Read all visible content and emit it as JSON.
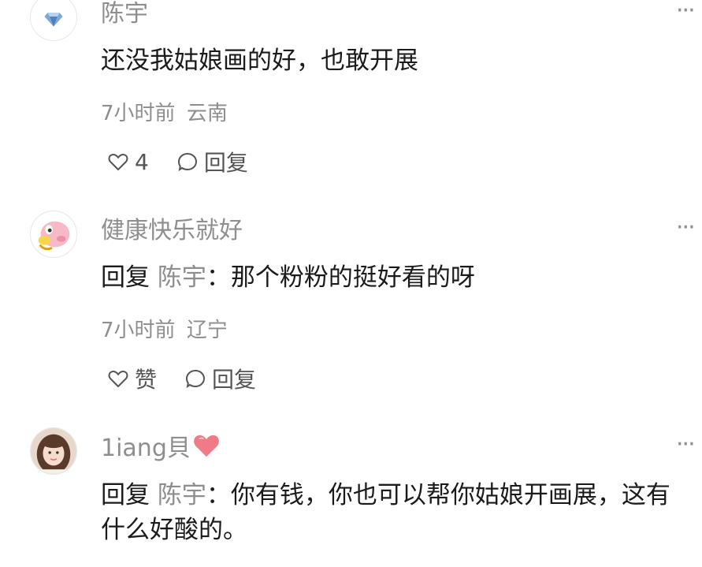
{
  "comments": [
    {
      "avatar": "diamond-avatar-icon",
      "username": "陈宇",
      "text": "还没我姑娘画的好，也敢开展",
      "time": "7小时前",
      "location": "云南",
      "like_count": "4",
      "reply_label": "回复",
      "more_label": "···"
    },
    {
      "avatar": "cartoon-pig-avatar",
      "username": "健康快乐就好",
      "reply_keyword": "回复",
      "reply_to": "陈宇",
      "reply_sep": "：",
      "text": "那个粉粉的挺好看的呀",
      "time": "7小时前",
      "location": "辽宁",
      "like_label": "赞",
      "reply_label": "回复",
      "more_label": "···"
    },
    {
      "avatar": "girl-photo-avatar",
      "username": "1iang貝",
      "username_emoji": "heart-icon",
      "reply_keyword": "回复",
      "reply_to": "陈宇",
      "reply_sep": "：",
      "text": "你有钱，你也可以帮你姑娘开画展，这有什么好酸的。",
      "more_label": "···"
    }
  ],
  "colors": {
    "text": "#1b1b1b",
    "secondary": "#8e8e8e",
    "action": "#555555",
    "heart": "#f07b86"
  }
}
